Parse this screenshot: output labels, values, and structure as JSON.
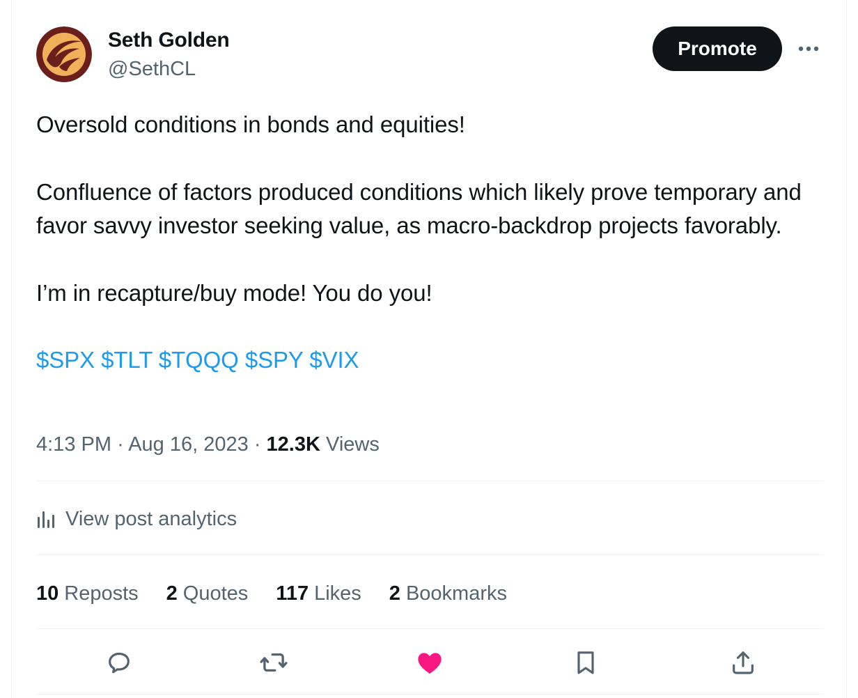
{
  "author": {
    "name": "Seth Golden",
    "handle": "@SethCL"
  },
  "header": {
    "promote_label": "Promote",
    "more_icon": "more-horizontal-icon"
  },
  "tweet": {
    "paragraphs": [
      "Oversold conditions in bonds and equities!",
      "Confluence of factors produced conditions which likely prove temporary and favor savvy investor seeking value, as macro-backdrop projects favorably.",
      "I’m in recapture/buy mode! You do you!"
    ],
    "cashtags": [
      "$SPX",
      "$TLT",
      "$TQQQ",
      "$SPY",
      "$VIX"
    ]
  },
  "meta": {
    "time": "4:13 PM",
    "date": "Aug 16, 2023",
    "separator": "·",
    "views_count": "12.3K",
    "views_label": "Views"
  },
  "analytics": {
    "label": "View post analytics",
    "icon": "analytics-bar-chart-icon"
  },
  "stats": {
    "reposts": {
      "count": "10",
      "label": "Reposts"
    },
    "quotes": {
      "count": "2",
      "label": "Quotes"
    },
    "likes": {
      "count": "117",
      "label": "Likes"
    },
    "bookmarks": {
      "count": "2",
      "label": "Bookmarks"
    }
  },
  "actions": {
    "reply_icon": "reply-icon",
    "repost_icon": "repost-icon",
    "like_icon": "heart-icon",
    "bookmark_icon": "bookmark-icon",
    "share_icon": "share-icon"
  },
  "colors": {
    "text_primary": "#0f1419",
    "text_secondary": "#536471",
    "link": "#1d9bf0",
    "like_active": "#f91880",
    "divider": "#eff3f4",
    "avatar_ring": "#6b1f1a",
    "avatar_fill": "#f0b15a"
  }
}
